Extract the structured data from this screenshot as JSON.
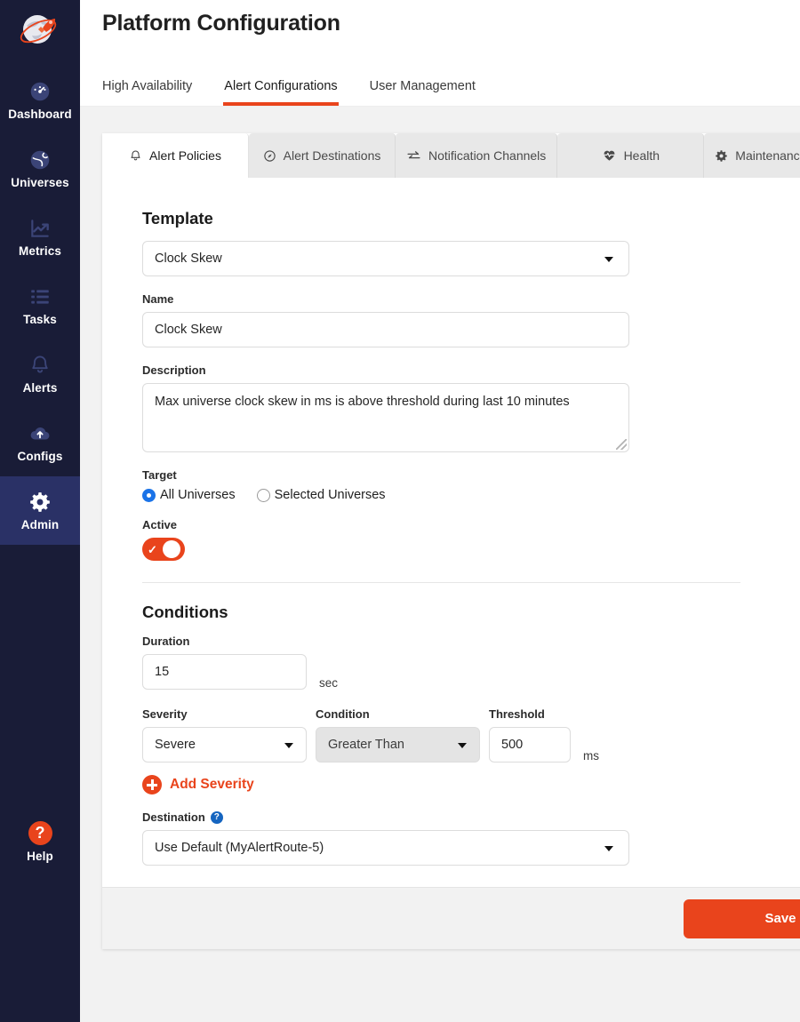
{
  "sidebar": {
    "logo": "yugabyte-rocket-globe-logo",
    "items": [
      {
        "label": "Dashboard",
        "icon": "dashboard-gauge-icon",
        "active": false
      },
      {
        "label": "Universes",
        "icon": "globe-icon",
        "active": false
      },
      {
        "label": "Metrics",
        "icon": "chart-line-icon",
        "active": false
      },
      {
        "label": "Tasks",
        "icon": "list-icon",
        "active": false
      },
      {
        "label": "Alerts",
        "icon": "bell-icon",
        "active": false
      },
      {
        "label": "Configs",
        "icon": "cloud-upload-icon",
        "active": false
      },
      {
        "label": "Admin",
        "icon": "gear-icon",
        "active": true
      }
    ],
    "help": {
      "label": "Help",
      "icon": "question-mark-icon"
    }
  },
  "header": {
    "title": "Platform Configuration",
    "tabs": [
      {
        "label": "High Availability",
        "active": false
      },
      {
        "label": "Alert Configurations",
        "active": true
      },
      {
        "label": "User Management",
        "active": false
      }
    ]
  },
  "subtabs": [
    {
      "label": "Alert Policies",
      "icon": "bell-icon",
      "active": true
    },
    {
      "label": "Alert Destinations",
      "icon": "target-icon",
      "active": false
    },
    {
      "label": "Notification Channels",
      "icon": "transfer-arrows-icon",
      "active": false
    },
    {
      "label": "Health",
      "icon": "heartbeat-icon",
      "active": false
    },
    {
      "label": "Maintenance Windows",
      "icon": "gear-icon",
      "active": false
    }
  ],
  "form": {
    "template": {
      "section_title": "Template",
      "value": "Clock Skew"
    },
    "name": {
      "label": "Name",
      "value": "Clock Skew"
    },
    "description": {
      "label": "Description",
      "value": "Max universe clock skew in ms is above threshold during last 10 minutes"
    },
    "target": {
      "label": "Target",
      "options": [
        {
          "label": "All Universes",
          "selected": true
        },
        {
          "label": "Selected Universes",
          "selected": false
        }
      ]
    },
    "active": {
      "label": "Active",
      "enabled": true
    }
  },
  "conditions": {
    "section_title": "Conditions",
    "duration": {
      "label": "Duration",
      "value": "15",
      "unit": "sec"
    },
    "severity": {
      "label": "Severity",
      "value": "Severe"
    },
    "condition": {
      "label": "Condition",
      "value": "Greater Than",
      "disabled": true
    },
    "threshold": {
      "label": "Threshold",
      "value": "500",
      "unit": "ms"
    },
    "add_severity_label": "Add Severity",
    "destination": {
      "label": "Destination",
      "help_icon": "question-mark-icon",
      "value": "Use Default (MyAlertRoute-5)"
    }
  },
  "footer": {
    "save_label": "Save"
  },
  "colors": {
    "accent": "#E9441C",
    "sidebar_bg": "#191C37",
    "sidebar_active": "#2A3166",
    "radio_selected": "#1A73E8",
    "page_bg": "#F2F2F2"
  }
}
